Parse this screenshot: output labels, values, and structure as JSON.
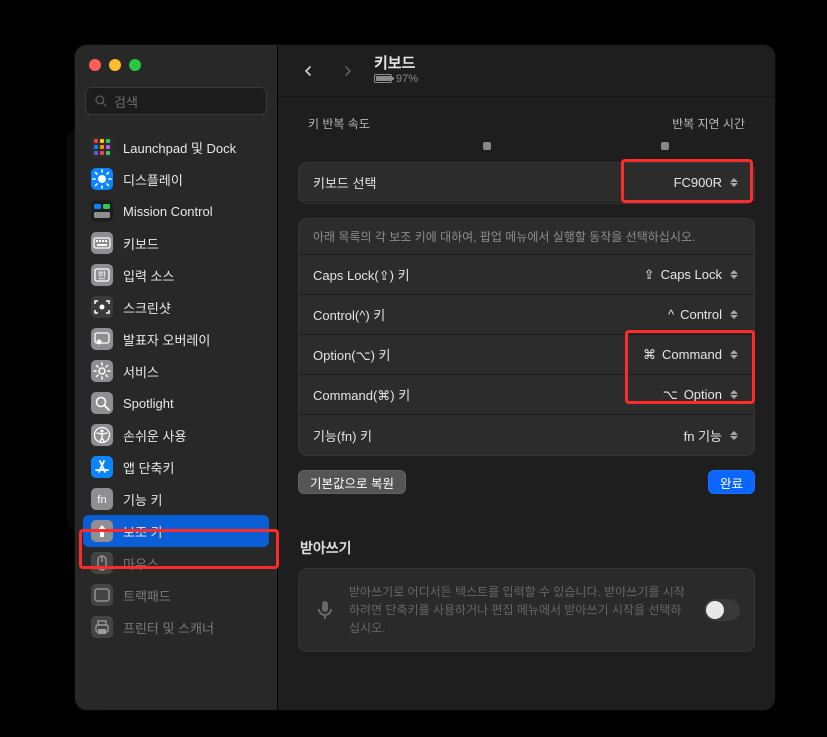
{
  "search": {
    "placeholder": "검색"
  },
  "header": {
    "title": "키보드",
    "battery_pct": "97%",
    "back_enabled": true,
    "forward_enabled": false
  },
  "top_labels": {
    "left": "키 반복 속도",
    "right": "반복 지연 시간"
  },
  "sidebar": {
    "items": [
      {
        "id": "launchpad",
        "label": "Launchpad 및 Dock",
        "iconBg": "#2d2d2d",
        "glyph": "grid-rocket"
      },
      {
        "id": "display",
        "label": "디스플레이",
        "iconBg": "#0a84ff",
        "glyph": "sun"
      },
      {
        "id": "mission",
        "label": "Mission Control",
        "iconBg": "#1e1e1e",
        "glyph": "mission"
      },
      {
        "id": "keyboard",
        "label": "키보드",
        "iconBg": "#8e8e93",
        "glyph": "keyboard"
      },
      {
        "id": "input",
        "label": "입력 소스",
        "iconBg": "#8e8e93",
        "glyph": "input"
      },
      {
        "id": "screenshot",
        "label": "스크린샷",
        "iconBg": "#3b3b3b",
        "glyph": "screenshot"
      },
      {
        "id": "presenter",
        "label": "발표자 오버레이",
        "iconBg": "#8e8e93",
        "glyph": "presenter"
      },
      {
        "id": "services",
        "label": "서비스",
        "iconBg": "#8e8e93",
        "glyph": "gear"
      },
      {
        "id": "spotlight",
        "label": "Spotlight",
        "iconBg": "#8e8e93",
        "glyph": "search"
      },
      {
        "id": "accessibility",
        "label": "손쉬운 사용",
        "iconBg": "#8e8e93",
        "glyph": "accessibility"
      },
      {
        "id": "shortcuts",
        "label": "앱 단축키",
        "iconBg": "#0a84ff",
        "glyph": "appstore"
      },
      {
        "id": "functionkeys",
        "label": "기능 키",
        "iconBg": "#8e8e93",
        "glyph": "fn"
      },
      {
        "id": "modifier",
        "label": "보조 키",
        "iconBg": "#8e8e93",
        "glyph": "up",
        "selected": true
      },
      {
        "id": "mouse",
        "label": "마우스",
        "iconBg": "#5c5c5c",
        "glyph": "mouse",
        "dim": true
      },
      {
        "id": "trackpad",
        "label": "트랙패드",
        "iconBg": "#5c5c5c",
        "glyph": "trackpad",
        "dim": true
      },
      {
        "id": "printers",
        "label": "프린터 및 스캐너",
        "iconBg": "#5c5c5c",
        "glyph": "printer",
        "dim": true
      }
    ]
  },
  "keyboard_select": {
    "label": "키보드 선택",
    "value": "FC900R"
  },
  "modifier_panel": {
    "hint": "아래 목록의 각 보조 키에 대하여, 팝업 메뉴에서 실행할 동작을 선택하십시오.",
    "rows": [
      {
        "label": "Caps Lock(⇪) 키",
        "value_prefix": "⇪",
        "value": "Caps Lock"
      },
      {
        "label": "Control(^) 키",
        "value_prefix": "^",
        "value": "Control"
      },
      {
        "label": "Option(⌥) 키",
        "value_prefix": "⌘",
        "value": "Command",
        "highlight": true
      },
      {
        "label": "Command(⌘) 키",
        "value_prefix": "⌥",
        "value": "Option",
        "highlight": true
      },
      {
        "label": "기능(fn) 키",
        "value_prefix": "",
        "value": "fn 기능"
      }
    ]
  },
  "buttons": {
    "restore": "기본값으로 복원",
    "done": "완료"
  },
  "dictation": {
    "heading": "받아쓰기",
    "text": "받아쓰기로 어디서든 텍스트를 입력할 수 있습니다. 받아쓰기를 시작하려면 단축키를 사용하거나 편집 메뉴에서 받아쓰기 시작을 선택하십시오.",
    "enabled": false
  },
  "highlights": {
    "sidebar_selected": true,
    "keyboard_select": true,
    "option_command_block": true
  }
}
